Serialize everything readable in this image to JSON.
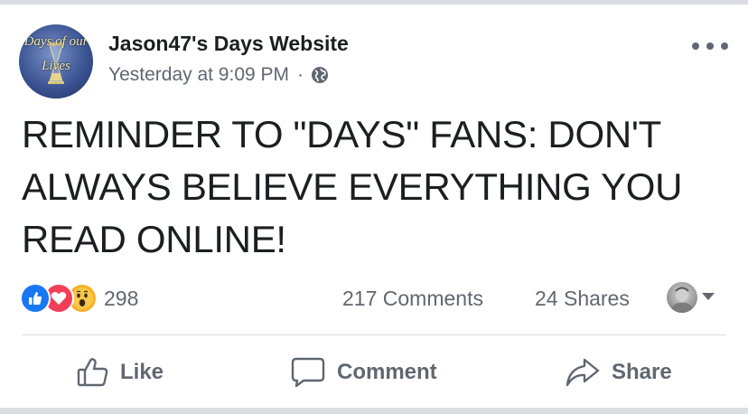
{
  "post": {
    "page_name": "Jason47's Days Website",
    "avatar_logo_line1": "Days of our",
    "avatar_logo_line2": "Lives",
    "timestamp": "Yesterday at 9:09 PM",
    "separator": "·",
    "privacy_icon": "globe-icon",
    "more_icon": "more-options-icon",
    "text": "REMINDER TO \"DAYS\" FANS: DON'T ALWAYS BELIEVE EVERYTHING YOU READ ONLINE!"
  },
  "stats": {
    "reaction_icons": [
      "like-reaction-icon",
      "love-reaction-icon",
      "wow-reaction-icon"
    ],
    "reaction_count": "298",
    "comments": "217 Comments",
    "shares": "24 Shares"
  },
  "actions": {
    "like_label": "Like",
    "comment_label": "Comment",
    "share_label": "Share"
  },
  "colors": {
    "like_blue": "#1877f2",
    "love_red": "#f33e58",
    "wow_yellow": "#f7b125",
    "secondary_text": "#606770"
  }
}
